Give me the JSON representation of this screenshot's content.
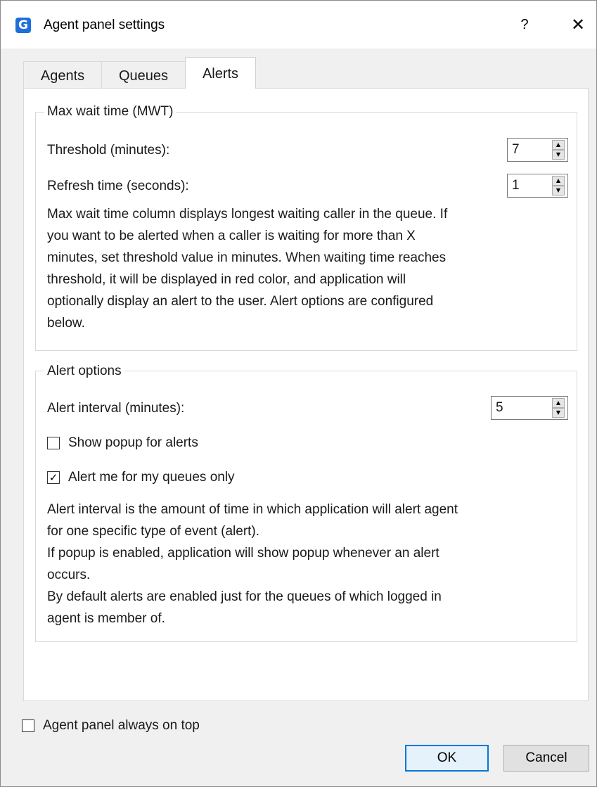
{
  "window": {
    "title": "Agent panel settings",
    "help_label": "?",
    "close_label": "✕"
  },
  "tabs": [
    {
      "label": "Agents",
      "selected": false
    },
    {
      "label": "Queues",
      "selected": false
    },
    {
      "label": "Alerts",
      "selected": true
    }
  ],
  "mwt": {
    "group_title": "Max wait time (MWT)",
    "threshold_label": "Threshold (minutes):",
    "threshold_value": "7",
    "refresh_label": "Refresh time (seconds):",
    "refresh_value": "1",
    "description": [
      "Max wait time column displays longest waiting caller in the queue. If",
      "you want to be alerted when a caller is waiting for more than X",
      "minutes, set threshold value in minutes. When waiting time reaches",
      "threshold, it will be displayed in red color, and application will",
      "optionally display an alert to the user. Alert options are configured",
      "below."
    ]
  },
  "alert_options": {
    "group_title": "Alert options",
    "interval_label": "Alert interval (minutes):",
    "interval_value": "5",
    "show_popup_label": "Show popup for alerts",
    "show_popup_checked": false,
    "my_queues_label": "Alert me for my queues only",
    "my_queues_checked": true,
    "description": [
      "Alert interval is the amount of time in which application will alert agent",
      "for one specific type of event (alert).",
      "If popup is enabled, application will show popup whenever an alert",
      "occurs.",
      "By default alerts are enabled just for the queues of which logged in",
      "agent is member of."
    ]
  },
  "footer": {
    "always_on_top_label": "Agent panel always on top",
    "always_on_top_checked": false,
    "ok_label": "OK",
    "cancel_label": "Cancel"
  },
  "glyphs": {
    "spin_up": "▲",
    "spin_down": "▼",
    "check_mark": "✓",
    "app_icon_letter": "G"
  },
  "colors": {
    "accent": "#0078d7",
    "app_icon": "#1e6fd9"
  }
}
